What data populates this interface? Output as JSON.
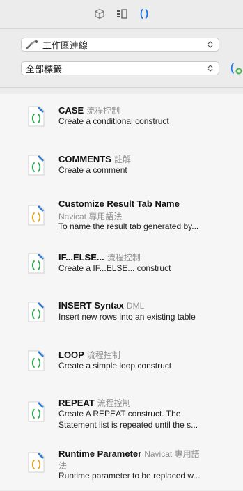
{
  "toolbar": {
    "icons": [
      "cube-icon",
      "layout-icon",
      "code-snippet-icon"
    ]
  },
  "connection_select": {
    "value": "工作區連線",
    "icon": "connection-icon"
  },
  "tag_select": {
    "value": "全部標籤"
  },
  "snippets": [
    {
      "title": "CASE",
      "tag": "流程控制",
      "desc": "Create a conditional construct"
    },
    {
      "title": "COMMENTS",
      "tag": "註解",
      "desc": "Create a comment"
    },
    {
      "title": "Customize Result Tab Name",
      "tag_line": "Navicat 專用語法",
      "desc": "To name the result tab generated by..."
    },
    {
      "title": "IF...ELSE...",
      "tag": "流程控制",
      "desc": "Create a IF...ELSE... construct"
    },
    {
      "title": "INSERT Syntax",
      "tag": "DML",
      "desc": "Insert new rows into an existing table"
    },
    {
      "title": "LOOP",
      "tag": "流程控制",
      "desc": "Create a simple loop construct"
    },
    {
      "title": "REPEAT",
      "tag": "流程控制",
      "desc": "Create A REPEAT construct. The",
      "desc2": "Statement list is repeated until the s..."
    },
    {
      "title": "Runtime Parameter",
      "tag": "Navicat 專用語",
      "tag_wrap": "法",
      "desc": "Runtime parameter to be replaced w..."
    }
  ]
}
